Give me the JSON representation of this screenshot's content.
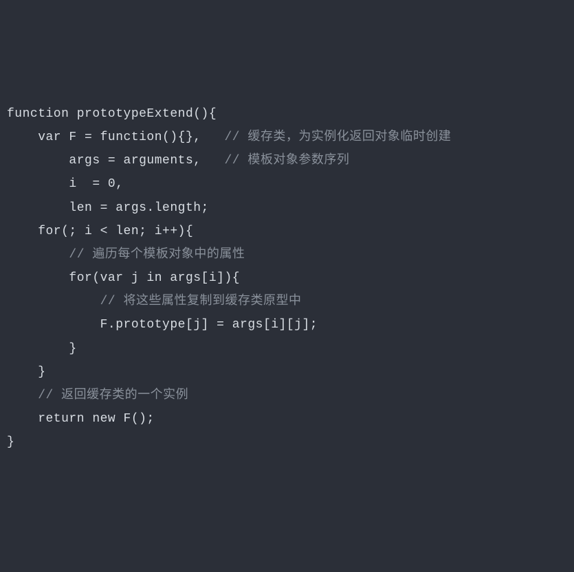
{
  "code": {
    "lines": [
      {
        "indent": 0,
        "code": "function prototypeExtend(){",
        "comment": ""
      },
      {
        "indent": 1,
        "code": "var F = function(){},",
        "comment": "   // 缓存类，为实例化返回对象临时创建"
      },
      {
        "indent": 2,
        "code": "args = arguments,",
        "comment": "   // 模板对象参数序列"
      },
      {
        "indent": 2,
        "code": "i  = 0,",
        "comment": ""
      },
      {
        "indent": 2,
        "code": "len = args.length;",
        "comment": ""
      },
      {
        "indent": 1,
        "code": "for(; i < len; i++){",
        "comment": ""
      },
      {
        "indent": 2,
        "code": "",
        "comment": "// 遍历每个模板对象中的属性"
      },
      {
        "indent": 2,
        "code": "for(var j in args[i]){",
        "comment": ""
      },
      {
        "indent": 3,
        "code": "",
        "comment": "// 将这些属性复制到缓存类原型中"
      },
      {
        "indent": 3,
        "code": "F.prototype[j] = args[i][j];",
        "comment": ""
      },
      {
        "indent": 2,
        "code": "}",
        "comment": ""
      },
      {
        "indent": 1,
        "code": "}",
        "comment": ""
      },
      {
        "indent": 1,
        "code": "",
        "comment": "// 返回缓存类的一个实例"
      },
      {
        "indent": 1,
        "code": "return new F();",
        "comment": ""
      },
      {
        "indent": 0,
        "code": "}",
        "comment": ""
      }
    ],
    "indentUnit": "    "
  }
}
